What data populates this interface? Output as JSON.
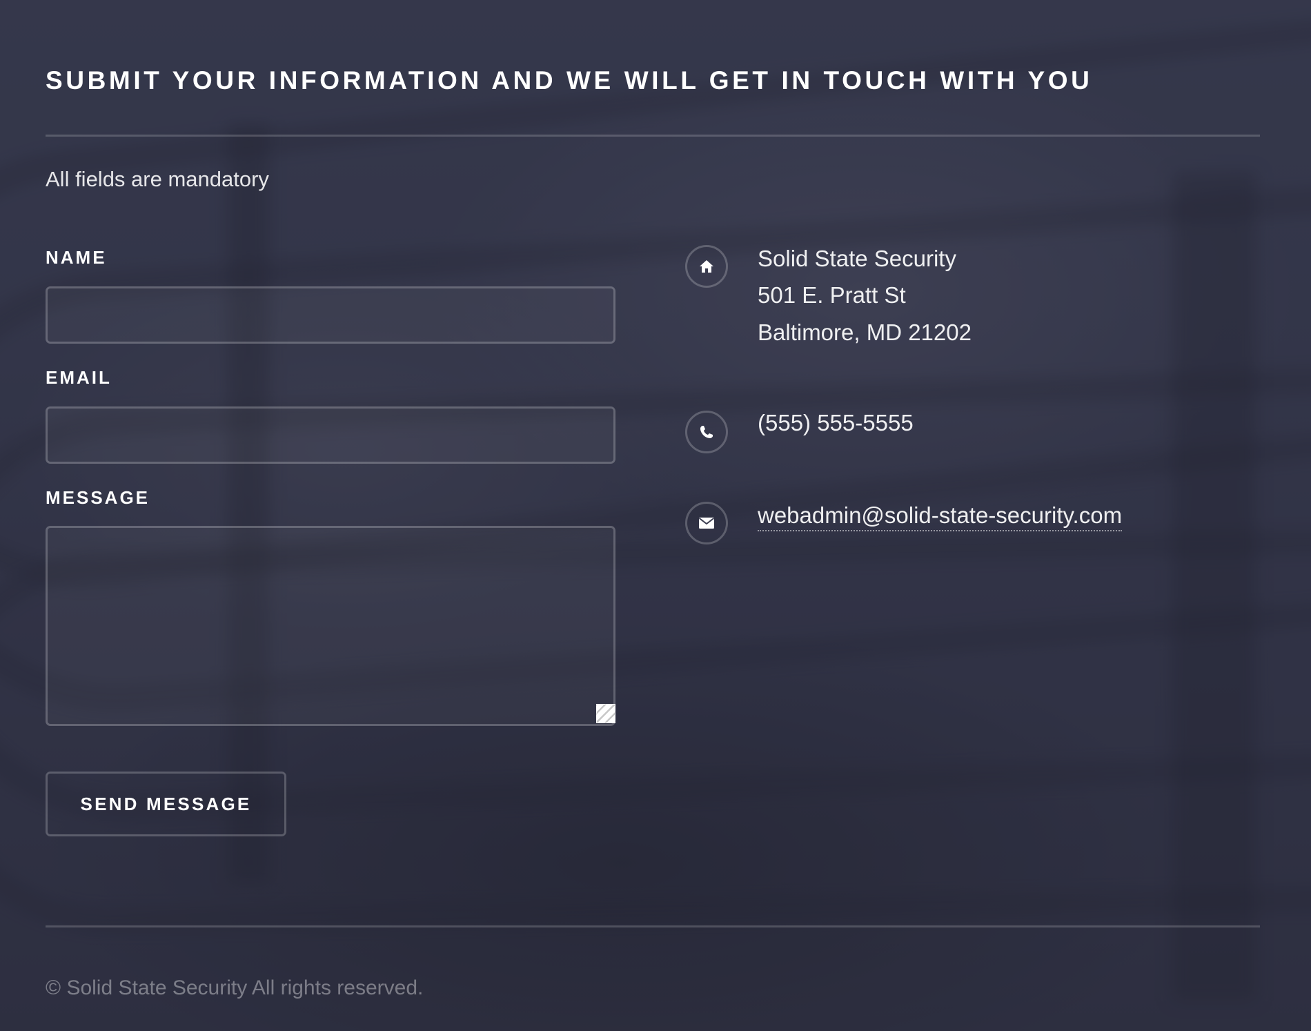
{
  "form": {
    "heading": "SUBMIT YOUR INFORMATION AND WE WILL GET IN TOUCH WITH YOU",
    "note": "All fields are mandatory",
    "name_label": "NAME",
    "name_value": "",
    "email_label": "EMAIL",
    "email_value": "",
    "message_label": "MESSAGE",
    "message_value": "",
    "send_label": "SEND MESSAGE"
  },
  "contact": {
    "company": "Solid State Security",
    "street": "501 E. Pratt St",
    "city_line": "Baltimore, MD 21202",
    "phone": "(555) 555-5555",
    "email": "webadmin@solid-state-security.com",
    "icons": [
      "home-icon",
      "phone-icon",
      "envelope-icon"
    ]
  },
  "footer": {
    "copyright": "© Solid State Security All rights reserved."
  },
  "colors": {
    "text": "#ffffff",
    "background": "#34374a",
    "border": "rgba(255,255,255,0.22)"
  }
}
